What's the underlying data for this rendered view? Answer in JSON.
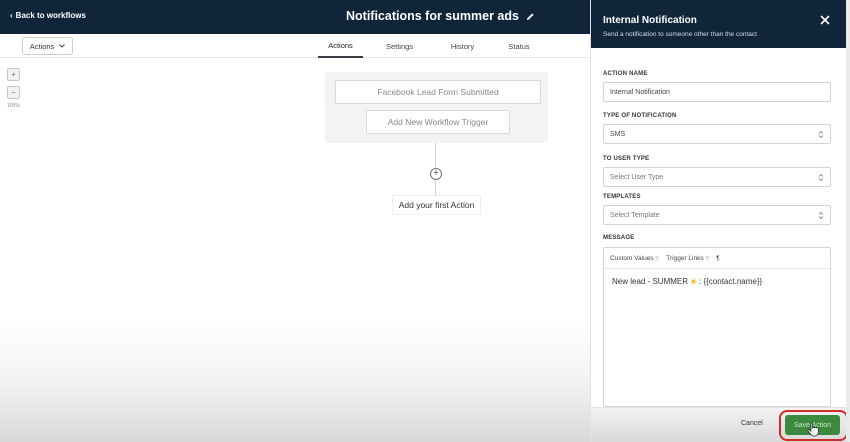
{
  "topbar": {
    "back_label": "Back to workflows",
    "title": "Notifications for summer ads"
  },
  "subbar": {
    "actions_dropdown": "Actions",
    "tabs": [
      {
        "label": "Actions",
        "active": true
      },
      {
        "label": "Settings",
        "active": false
      },
      {
        "label": "History",
        "active": false
      },
      {
        "label": "Status",
        "active": false
      }
    ]
  },
  "canvas": {
    "zoom_in": "+",
    "zoom_out": "−",
    "zoom_level": "100%",
    "trigger": "Facebook Lead Form Submitted",
    "add_trigger": "Add New Workflow Trigger",
    "add_step": "+",
    "first_action": "Add your first Action"
  },
  "panel": {
    "title": "Internal Notification",
    "subtitle": "Send a notification to someone other than the contact",
    "action_name_label": "ACTION NAME",
    "action_name_value": "Internal Notification",
    "notification_type_label": "TYPE OF NOTIFICATION",
    "notification_type_value": "SMS",
    "user_type_label": "TO USER TYPE",
    "user_type_placeholder": "Select User Type",
    "templates_label": "TEMPLATES",
    "templates_placeholder": "Select Template",
    "message_label": "MESSAGE",
    "toolbar": {
      "custom_values": "Custom Values",
      "trigger_links": "Trigger Links",
      "paragraph": "¶"
    },
    "message_before": "New lead - SUMMER",
    "message_after": ": {{contact.name}}",
    "cancel_label": "Cancel",
    "save_label": "Save Action"
  },
  "colors": {
    "header_bg": "#10253a",
    "save_bg": "#3c8a3f",
    "highlight": "#d32a2a"
  }
}
